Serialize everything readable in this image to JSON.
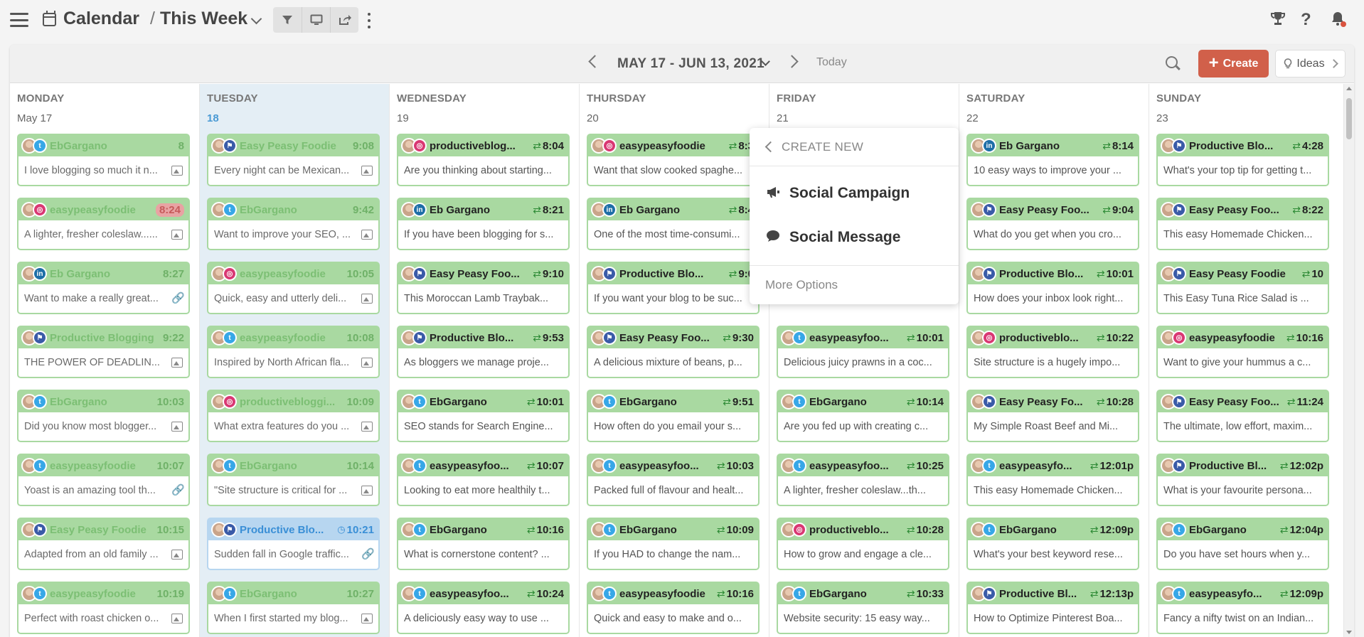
{
  "header": {
    "breadcrumb_root": "Calendar",
    "breadcrumb_separator": "/",
    "breadcrumb_current": "This Week"
  },
  "toolbar": {
    "filter_icon": "filter-icon",
    "display_icon": "monitor-icon",
    "share_icon": "share-icon"
  },
  "panel": {
    "date_range": "MAY 17 - JUN 13, 2021",
    "today_label": "Today",
    "create_label": "Create",
    "ideas_label": "Ideas"
  },
  "popup": {
    "title": "CREATE NEW",
    "items": [
      "Social Campaign",
      "Social Message"
    ],
    "more": "More Options"
  },
  "colors": {
    "accent": "#d1604a",
    "card_green": "#a9d9a1",
    "card_blue": "#b7d6f0",
    "today_bg": "#e4eef5"
  },
  "days": [
    {
      "name": "MONDAY",
      "date": "May 17",
      "today": false,
      "cards": [
        {
          "net": "twitter",
          "account": "EbGargano",
          "time": "8",
          "text": "I love blogging so much it n...",
          "att": "img",
          "state": "draft"
        },
        {
          "net": "instagram",
          "account": "easypeasyfoodie",
          "time": "8:24",
          "time_style": "pill",
          "text": "A lighter, fresher coleslaw......",
          "att": "img",
          "state": "draft"
        },
        {
          "net": "linkedin",
          "account": "Eb Gargano",
          "time": "8:27",
          "text": "Want to make a really great...",
          "att": "link",
          "state": "draft"
        },
        {
          "net": "facebook",
          "account": "Productive Blogging",
          "time": "9:22",
          "text": "THE POWER OF DEADLIN...",
          "att": "img",
          "state": "draft"
        },
        {
          "net": "twitter",
          "account": "EbGargano",
          "time": "10:03",
          "text": "Did you know most blogger...",
          "att": "img",
          "state": "draft"
        },
        {
          "net": "twitter",
          "account": "easypeasyfoodie",
          "time": "10:07",
          "text": "Yoast is an amazing tool th...",
          "att": "link",
          "state": "draft"
        },
        {
          "net": "facebook",
          "account": "Easy Peasy Foodie",
          "time": "10:15",
          "text": "Adapted from an old family ...",
          "att": "img",
          "state": "draft"
        },
        {
          "net": "twitter",
          "account": "easypeasyfoodie",
          "time": "10:19",
          "text": "Perfect with roast chicken o...",
          "att": "img",
          "state": "draft"
        }
      ]
    },
    {
      "name": "TUESDAY",
      "date": "18",
      "today": true,
      "cards": [
        {
          "net": "facebook",
          "account": "Easy Peasy Foodie",
          "time": "9:08",
          "text": "Every night can be Mexican...",
          "att": "img",
          "state": "draft"
        },
        {
          "net": "twitter",
          "account": "EbGargano",
          "time": "9:42",
          "text": "Want to improve your SEO, ...",
          "att": "img",
          "state": "draft"
        },
        {
          "net": "instagram",
          "account": "easypeasyfoodie",
          "time": "10:05",
          "text": "Quick, easy and utterly deli...",
          "att": "img",
          "state": "draft"
        },
        {
          "net": "twitter",
          "account": "easypeasyfoodie",
          "time": "10:08",
          "text": "Inspired by North African fla...",
          "att": "img",
          "state": "draft"
        },
        {
          "net": "instagram",
          "account": "productivebloggi...",
          "time": "10:09",
          "text": "What extra features do you ...",
          "att": "img",
          "state": "draft"
        },
        {
          "net": "twitter",
          "account": "EbGargano",
          "time": "10:14",
          "text": "\"Site structure is critical for ...",
          "att": "img",
          "state": "draft"
        },
        {
          "net": "facebook",
          "account": "Productive Blo...",
          "time": "10:21",
          "clock": true,
          "text": "Sudden fall in Google traffic...",
          "att": "link",
          "state": "blue"
        },
        {
          "net": "twitter",
          "account": "EbGargano",
          "time": "10:27",
          "text": "When I first started my blog...",
          "att": "img",
          "state": "draft"
        }
      ]
    },
    {
      "name": "WEDNESDAY",
      "date": "19",
      "today": false,
      "cards": [
        {
          "net": "instagram",
          "account": "productiveblog...",
          "time": "8:04",
          "shuffle": true,
          "text": "Are you thinking about starting...",
          "att": "",
          "state": "sched"
        },
        {
          "net": "linkedin",
          "account": "Eb Gargano",
          "time": "8:21",
          "shuffle": true,
          "text": "If you have been blogging for s...",
          "att": "",
          "state": "sched"
        },
        {
          "net": "facebook",
          "account": "Easy Peasy Foo...",
          "time": "9:10",
          "shuffle": true,
          "text": "This Moroccan Lamb Traybak...",
          "att": "",
          "state": "sched"
        },
        {
          "net": "facebook",
          "account": "Productive Blo...",
          "time": "9:53",
          "shuffle": true,
          "text": "As bloggers we manage proje...",
          "att": "",
          "state": "sched"
        },
        {
          "net": "twitter",
          "account": "EbGargano",
          "time": "10:01",
          "shuffle": true,
          "text": "SEO stands for Search Engine...",
          "att": "",
          "state": "sched"
        },
        {
          "net": "twitter",
          "account": "easypeasyfoo...",
          "time": "10:07",
          "shuffle": true,
          "text": "Looking to eat more healthily t...",
          "att": "",
          "state": "sched"
        },
        {
          "net": "twitter",
          "account": "EbGargano",
          "time": "10:16",
          "shuffle": true,
          "text": "What is cornerstone content? ...",
          "att": "",
          "state": "sched"
        },
        {
          "net": "twitter",
          "account": "easypeasyfoo...",
          "time": "10:24",
          "shuffle": true,
          "text": "A deliciously easy way to use ...",
          "att": "",
          "state": "sched"
        }
      ]
    },
    {
      "name": "THURSDAY",
      "date": "20",
      "today": false,
      "cards": [
        {
          "net": "instagram",
          "account": "easypeasyfoodie",
          "time": "8:3",
          "shuffle": true,
          "text": "Want that slow cooked spaghe...",
          "att": "",
          "state": "sched"
        },
        {
          "net": "linkedin",
          "account": "Eb Gargano",
          "time": "8:4",
          "shuffle": true,
          "text": "One of the most time-consumi...",
          "att": "",
          "state": "sched"
        },
        {
          "net": "facebook",
          "account": "Productive Blo...",
          "time": "9:0",
          "shuffle": true,
          "text": "If you want your blog to be suc...",
          "att": "",
          "state": "sched"
        },
        {
          "net": "facebook",
          "account": "Easy Peasy Foo...",
          "time": "9:30",
          "shuffle": true,
          "text": "A delicious mixture of beans, p...",
          "att": "",
          "state": "sched"
        },
        {
          "net": "twitter",
          "account": "EbGargano",
          "time": "9:51",
          "shuffle": true,
          "text": "How often do you email your s...",
          "att": "",
          "state": "sched"
        },
        {
          "net": "twitter",
          "account": "easypeasyfoo...",
          "time": "10:03",
          "shuffle": true,
          "text": "Packed full of flavour and healt...",
          "att": "",
          "state": "sched"
        },
        {
          "net": "twitter",
          "account": "EbGargano",
          "time": "10:09",
          "shuffle": true,
          "text": "If you HAD to change the nam...",
          "att": "",
          "state": "sched"
        },
        {
          "net": "twitter",
          "account": "easypeasyfoodie",
          "time": "10:16",
          "shuffle": true,
          "text": "Quick and easy to make and o...",
          "att": "",
          "state": "sched"
        }
      ]
    },
    {
      "name": "FRIDAY",
      "date": "21",
      "today": false,
      "cards": [
        {
          "net": "twitter",
          "account": "",
          "time": "",
          "text": "",
          "att": "",
          "state": "sched",
          "hidden": true
        },
        {
          "net": "twitter",
          "account": "",
          "time": "",
          "text": "",
          "att": "",
          "state": "sched",
          "hidden": true
        },
        {
          "net": "twitter",
          "account": "",
          "time": "",
          "text": "",
          "att": "",
          "state": "sched",
          "hidden": true
        },
        {
          "net": "twitter",
          "account": "easypeasyfoo...",
          "time": "10:01",
          "shuffle": true,
          "text": "Delicious juicy prawns in a coc...",
          "att": "",
          "state": "sched"
        },
        {
          "net": "twitter",
          "account": "EbGargano",
          "time": "10:14",
          "shuffle": true,
          "text": "Are you fed up with creating c...",
          "att": "",
          "state": "sched"
        },
        {
          "net": "twitter",
          "account": "easypeasyfoo...",
          "time": "10:25",
          "shuffle": true,
          "text": "A lighter, fresher coleslaw...th...",
          "att": "",
          "state": "sched"
        },
        {
          "net": "instagram",
          "account": "productiveblo...",
          "time": "10:28",
          "shuffle": true,
          "text": "How to grow and engage a cle...",
          "att": "",
          "state": "sched"
        },
        {
          "net": "twitter",
          "account": "EbGargano",
          "time": "10:33",
          "shuffle": true,
          "text": "Website security: 15 easy way...",
          "att": "",
          "state": "sched"
        }
      ]
    },
    {
      "name": "SATURDAY",
      "date": "22",
      "today": false,
      "cards": [
        {
          "net": "linkedin",
          "account": "Eb Gargano",
          "time": "8:14",
          "shuffle": true,
          "text": "10 easy ways to improve your ...",
          "att": "",
          "state": "sched"
        },
        {
          "net": "facebook",
          "account": "Easy Peasy Foo...",
          "time": "9:04",
          "shuffle": true,
          "text": "What do you get when you cro...",
          "att": "",
          "state": "sched"
        },
        {
          "net": "facebook",
          "account": "Productive Blo...",
          "time": "10:01",
          "shuffle": true,
          "text": "How does your inbox look right...",
          "att": "",
          "state": "sched"
        },
        {
          "net": "instagram",
          "account": "productiveblo...",
          "time": "10:22",
          "shuffle": true,
          "text": "Site structure is a hugely impo...",
          "att": "",
          "state": "sched"
        },
        {
          "net": "facebook",
          "account": "Easy Peasy Fo...",
          "time": "10:28",
          "shuffle": true,
          "text": "My Simple Roast Beef and Mi...",
          "att": "",
          "state": "sched"
        },
        {
          "net": "twitter",
          "account": "easypeasyfo...",
          "time": "12:01p",
          "shuffle": true,
          "text": "This easy Homemade Chicken...",
          "att": "",
          "state": "sched"
        },
        {
          "net": "twitter",
          "account": "EbGargano",
          "time": "12:09p",
          "shuffle": true,
          "text": "What's your best keyword rese...",
          "att": "",
          "state": "sched"
        },
        {
          "net": "facebook",
          "account": "Productive Bl...",
          "time": "12:13p",
          "shuffle": true,
          "text": "How to Optimize Pinterest Boa...",
          "att": "",
          "state": "sched"
        }
      ]
    },
    {
      "name": "SUNDAY",
      "date": "23",
      "today": false,
      "cards": [
        {
          "net": "facebook",
          "account": "Productive Blo...",
          "time": "4:28",
          "shuffle": true,
          "text": "What's your top tip for getting t...",
          "att": "",
          "state": "sched"
        },
        {
          "net": "facebook",
          "account": "Easy Peasy Foo...",
          "time": "8:22",
          "shuffle": true,
          "text": "This easy Homemade Chicken...",
          "att": "",
          "state": "sched"
        },
        {
          "net": "facebook",
          "account": "Easy Peasy Foodie",
          "time": "10",
          "shuffle": true,
          "text": "This Easy Tuna Rice Salad is ...",
          "att": "",
          "state": "sched"
        },
        {
          "net": "instagram",
          "account": "easypeasyfoodie",
          "time": "10:16",
          "shuffle": true,
          "text": "Want to give your hummus a c...",
          "att": "",
          "state": "sched"
        },
        {
          "net": "facebook",
          "account": "Easy Peasy Foo...",
          "time": "11:24",
          "shuffle": true,
          "text": "The ultimate, low effort, maxim...",
          "att": "",
          "state": "sched"
        },
        {
          "net": "facebook",
          "account": "Productive Bl...",
          "time": "12:02p",
          "shuffle": true,
          "text": "What is your favourite persona...",
          "att": "",
          "state": "sched"
        },
        {
          "net": "twitter",
          "account": "EbGargano",
          "time": "12:04p",
          "shuffle": true,
          "text": "Do you have set hours when y...",
          "att": "",
          "state": "sched"
        },
        {
          "net": "twitter",
          "account": "easypeasyfo...",
          "time": "12:09p",
          "shuffle": true,
          "text": "Fancy a nifty twist on an Indian...",
          "att": "",
          "state": "sched"
        }
      ]
    }
  ]
}
